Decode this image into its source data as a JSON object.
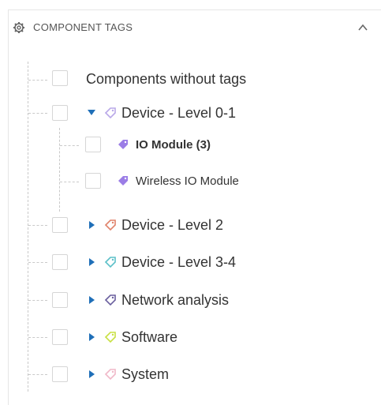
{
  "header": {
    "title": "COMPONENT TAGS",
    "icon": "gear-icon",
    "collapse_icon": "chevron-up-icon"
  },
  "tree": [
    {
      "label": "Components without tags",
      "level": 0,
      "has_tag": false
    },
    {
      "label": "Device - Level 0-1",
      "level": 0,
      "expanded": true,
      "tag_color": "#b9a8e8"
    },
    {
      "label": "IO Module (3)",
      "level": 1,
      "bold": true,
      "tag_color": "#9b7de6"
    },
    {
      "label": "Wireless IO Module",
      "level": 1,
      "bold": false,
      "tag_color": "#9b7de6"
    },
    {
      "label": "Device - Level 2",
      "level": 0,
      "expanded": false,
      "tag_color": "#e0826a"
    },
    {
      "label": "Device - Level 3-4",
      "level": 0,
      "expanded": false,
      "tag_color": "#5cc0c8"
    },
    {
      "label": "Network analysis",
      "level": 0,
      "expanded": false,
      "tag_color": "#6a5f9e"
    },
    {
      "label": "Software",
      "level": 0,
      "expanded": false,
      "tag_color": "#c8e043"
    },
    {
      "label": "System",
      "level": 0,
      "expanded": false,
      "tag_color": "#f0b8c8"
    }
  ],
  "colors": {
    "arrow": "#1f6fb8",
    "border": "#d6d6d6",
    "text": "#333333"
  }
}
